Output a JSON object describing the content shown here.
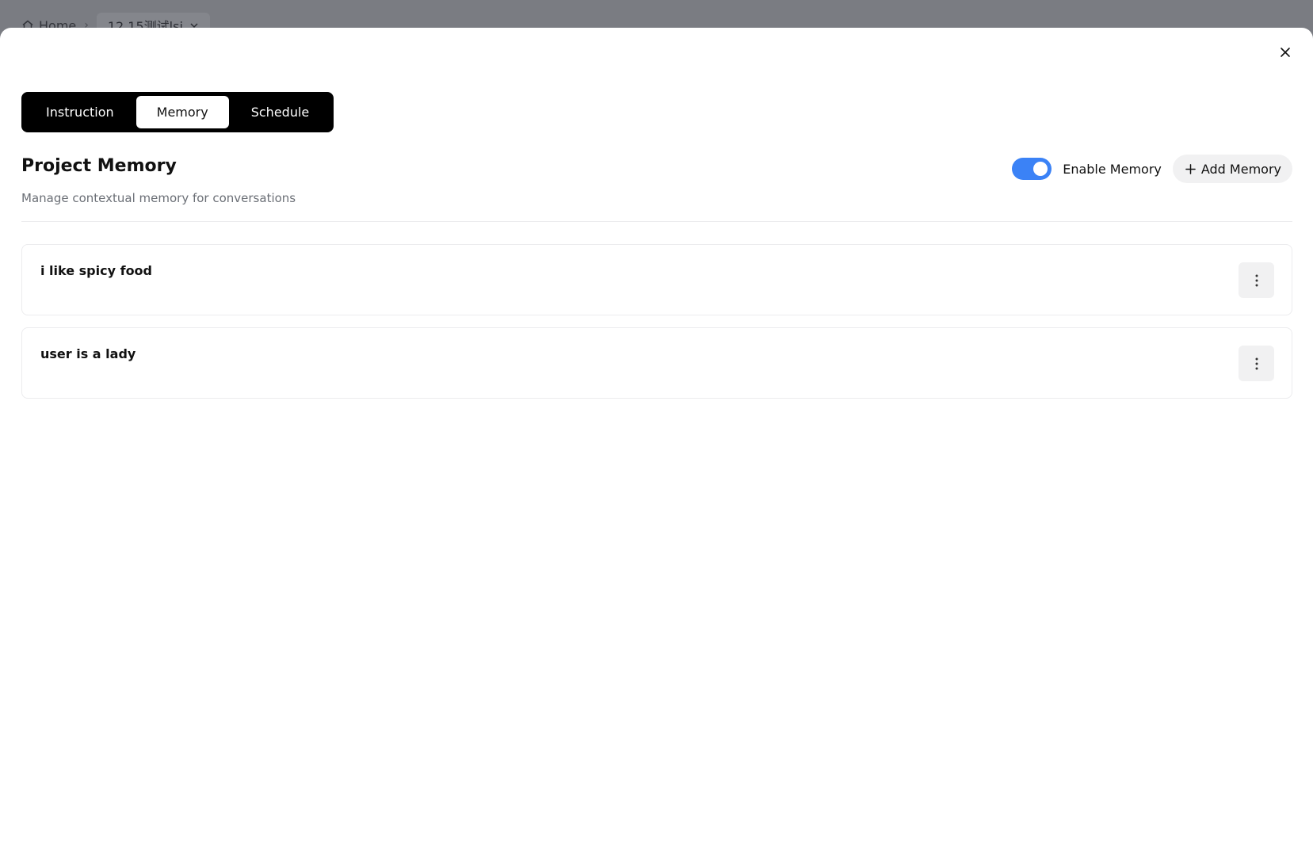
{
  "background": {
    "breadcrumb": {
      "home_label": "Home",
      "project_label": "12.15测试lsi"
    }
  },
  "tabs": [
    {
      "label": "Instruction",
      "active": false
    },
    {
      "label": "Memory",
      "active": true
    },
    {
      "label": "Schedule",
      "active": false
    }
  ],
  "header": {
    "title": "Project Memory",
    "subtitle": "Manage contextual memory for conversations",
    "toggle_label": "Enable Memory",
    "toggle_on": true,
    "add_label": "Add Memory"
  },
  "memories": [
    {
      "text": "i like spicy food"
    },
    {
      "text": "user is a lady"
    }
  ],
  "colors": {
    "accent": "#3b82f6",
    "tab_bar": "#000000",
    "overlay": "#7a7c82"
  },
  "icons": {
    "close": "close-icon",
    "add": "plus-icon",
    "more": "more-vertical-icon",
    "home": "home-icon",
    "chevron": "chevron-down-icon"
  }
}
